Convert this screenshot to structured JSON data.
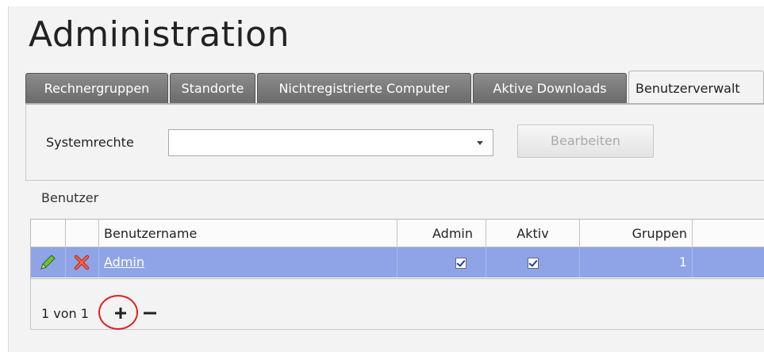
{
  "page": {
    "title": "Administration"
  },
  "tabs": [
    {
      "label": "Rechnergruppen"
    },
    {
      "label": "Standorte"
    },
    {
      "label": "Nichtregistrierte Computer"
    },
    {
      "label": "Aktive Downloads"
    },
    {
      "label": "Benutzerverwalt"
    }
  ],
  "rights": {
    "label": "Systemrechte",
    "select_value": "",
    "edit_button": "Bearbeiten"
  },
  "users": {
    "section_label": "Benutzer",
    "columns": {
      "name": "Benutzername",
      "admin": "Admin",
      "active": "Aktiv",
      "groups": "Gruppen"
    },
    "rows": [
      {
        "name": "Admin",
        "admin": true,
        "active": true,
        "groups": "1"
      }
    ]
  },
  "pager": {
    "text": "1 von 1"
  },
  "colors": {
    "selected_row": "#8ea4e6",
    "highlight_ring": "#e02020",
    "tab_inactive": "#7a7a7a"
  },
  "icons": {
    "edit": "pencil-icon",
    "delete": "delete-x-icon",
    "add": "plus-icon",
    "remove": "minus-icon"
  }
}
